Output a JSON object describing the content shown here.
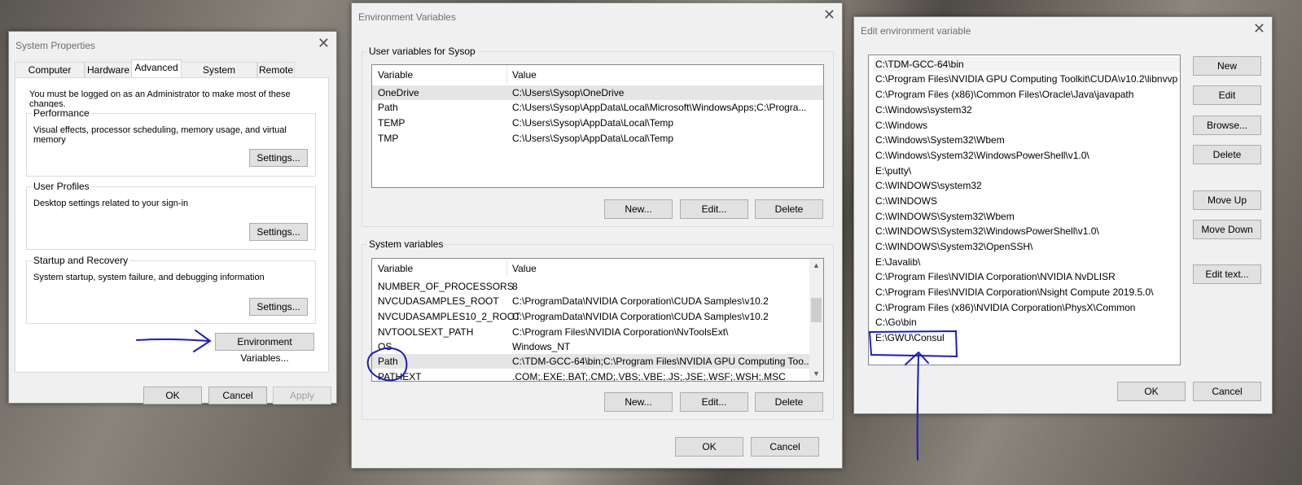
{
  "system_properties": {
    "title": "System Properties",
    "tabs": [
      "Computer Name",
      "Hardware",
      "Advanced",
      "System Protection",
      "Remote"
    ],
    "admin_note": "You must be logged on as an Administrator to make most of these changes.",
    "performance": {
      "label": "Performance",
      "desc": "Visual effects, processor scheduling, memory usage, and virtual memory",
      "button": "Settings..."
    },
    "user_profiles": {
      "label": "User Profiles",
      "desc": "Desktop settings related to your sign-in",
      "button": "Settings..."
    },
    "startup": {
      "label": "Startup and Recovery",
      "desc": "System startup, system failure, and debugging information",
      "button": "Settings..."
    },
    "env_button": "Environment Variables...",
    "ok": "OK",
    "cancel": "Cancel",
    "apply": "Apply"
  },
  "env_vars": {
    "title": "Environment Variables",
    "user_group": "User variables for Sysop",
    "col_variable": "Variable",
    "col_value": "Value",
    "user_rows": [
      {
        "name": "OneDrive",
        "value": "C:\\Users\\Sysop\\OneDrive"
      },
      {
        "name": "Path",
        "value": "C:\\Users\\Sysop\\AppData\\Local\\Microsoft\\WindowsApps;C:\\Progra..."
      },
      {
        "name": "TEMP",
        "value": "C:\\Users\\Sysop\\AppData\\Local\\Temp"
      },
      {
        "name": "TMP",
        "value": "C:\\Users\\Sysop\\AppData\\Local\\Temp"
      }
    ],
    "system_group": "System variables",
    "system_rows": [
      {
        "name": "NUMBER_OF_PROCESSORS",
        "value": "8"
      },
      {
        "name": "NVCUDASAMPLES_ROOT",
        "value": "C:\\ProgramData\\NVIDIA Corporation\\CUDA Samples\\v10.2"
      },
      {
        "name": "NVCUDASAMPLES10_2_ROOT",
        "value": "C:\\ProgramData\\NVIDIA Corporation\\CUDA Samples\\v10.2"
      },
      {
        "name": "NVTOOLSEXT_PATH",
        "value": "C:\\Program Files\\NVIDIA Corporation\\NvToolsExt\\"
      },
      {
        "name": "OS",
        "value": "Windows_NT"
      },
      {
        "name": "Path",
        "value": "C:\\TDM-GCC-64\\bin;C:\\Program Files\\NVIDIA GPU Computing Too..."
      },
      {
        "name": "PATHEXT",
        "value": ".COM;.EXE;.BAT;.CMD;.VBS;.VBE;.JS;.JSE;.WSF;.WSH;.MSC"
      }
    ],
    "new": "New...",
    "edit": "Edit...",
    "delete": "Delete",
    "ok": "OK",
    "cancel": "Cancel"
  },
  "edit_env": {
    "title": "Edit environment variable",
    "items": [
      "C:\\TDM-GCC-64\\bin",
      "C:\\Program Files\\NVIDIA GPU Computing Toolkit\\CUDA\\v10.2\\libnvvp",
      "C:\\Program Files (x86)\\Common Files\\Oracle\\Java\\javapath",
      "C:\\Windows\\system32",
      "C:\\Windows",
      "C:\\Windows\\System32\\Wbem",
      "C:\\Windows\\System32\\WindowsPowerShell\\v1.0\\",
      "E:\\putty\\",
      "C:\\WINDOWS\\system32",
      "C:\\WINDOWS",
      "C:\\WINDOWS\\System32\\Wbem",
      "C:\\WINDOWS\\System32\\WindowsPowerShell\\v1.0\\",
      "C:\\WINDOWS\\System32\\OpenSSH\\",
      "E:\\Javalib\\",
      "C:\\Program Files\\NVIDIA Corporation\\NVIDIA NvDLISR",
      "C:\\Program Files\\NVIDIA Corporation\\Nsight Compute 2019.5.0\\",
      "C:\\Program Files (x86)\\NVIDIA Corporation\\PhysX\\Common",
      "C:\\Go\\bin",
      "E:\\GWU\\Consul"
    ],
    "buttons": {
      "new": "New",
      "edit": "Edit",
      "browse": "Browse...",
      "delete": "Delete",
      "move_up": "Move Up",
      "move_down": "Move Down",
      "edit_text": "Edit text..."
    },
    "ok": "OK",
    "cancel": "Cancel"
  },
  "annotation_color": "#1a1acc"
}
